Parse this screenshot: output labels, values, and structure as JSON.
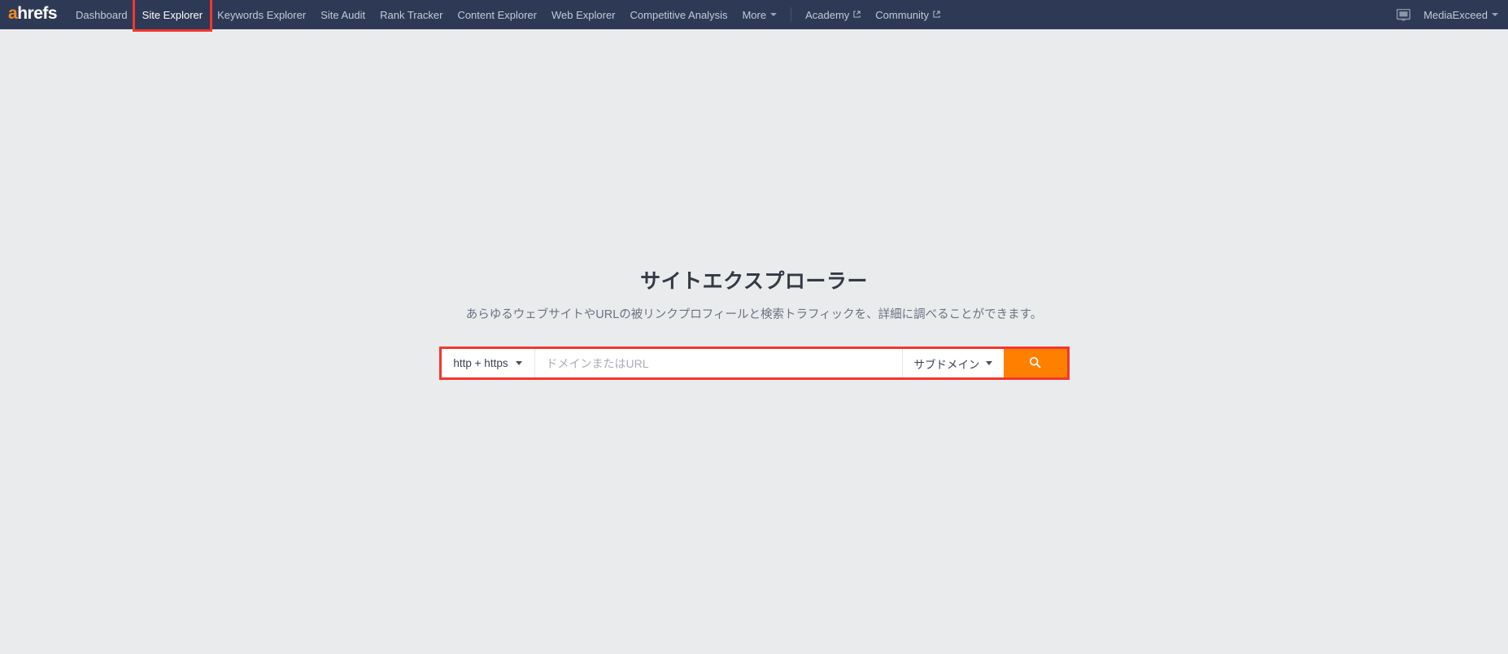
{
  "nav": {
    "logo": {
      "accent_letter": "a",
      "rest": "hrefs",
      "accent_color": "#f28b22"
    },
    "items": [
      {
        "label": "Dashboard",
        "name": "dashboard",
        "active": false,
        "highlighted": false
      },
      {
        "label": "Site Explorer",
        "name": "site-explorer",
        "active": true,
        "highlighted": true
      },
      {
        "label": "Keywords Explorer",
        "name": "keywords-explorer",
        "active": false,
        "highlighted": false
      },
      {
        "label": "Site Audit",
        "name": "site-audit",
        "active": false,
        "highlighted": false
      },
      {
        "label": "Rank Tracker",
        "name": "rank-tracker",
        "active": false,
        "highlighted": false
      },
      {
        "label": "Content Explorer",
        "name": "content-explorer",
        "active": false,
        "highlighted": false
      },
      {
        "label": "Web Explorer",
        "name": "web-explorer",
        "active": false,
        "highlighted": false
      },
      {
        "label": "Competitive Analysis",
        "name": "competitive-analysis",
        "active": false,
        "highlighted": false
      },
      {
        "label": "More",
        "name": "more",
        "active": false,
        "highlighted": false,
        "caret": true
      }
    ],
    "external_items": [
      {
        "label": "Academy",
        "name": "academy"
      },
      {
        "label": "Community",
        "name": "community"
      }
    ],
    "right": {
      "monitor_icon": "monitor-icon",
      "account_label": "MediaExceed"
    },
    "bg_color": "#2e3a55",
    "text_color": "#c3cad7"
  },
  "hero": {
    "title": "サイトエクスプローラー",
    "subtitle": "あらゆるウェブサイトやURLの被リンクプロフィールと検索トラフィックを、詳細に調べることができます。"
  },
  "search": {
    "protocol_value": "http + https",
    "input_value": "",
    "input_placeholder": "ドメインまたはURL",
    "mode_value": "サブドメイン",
    "search_icon": "search-icon",
    "button_color": "#ff8000",
    "highlight_color": "#f4362e"
  }
}
